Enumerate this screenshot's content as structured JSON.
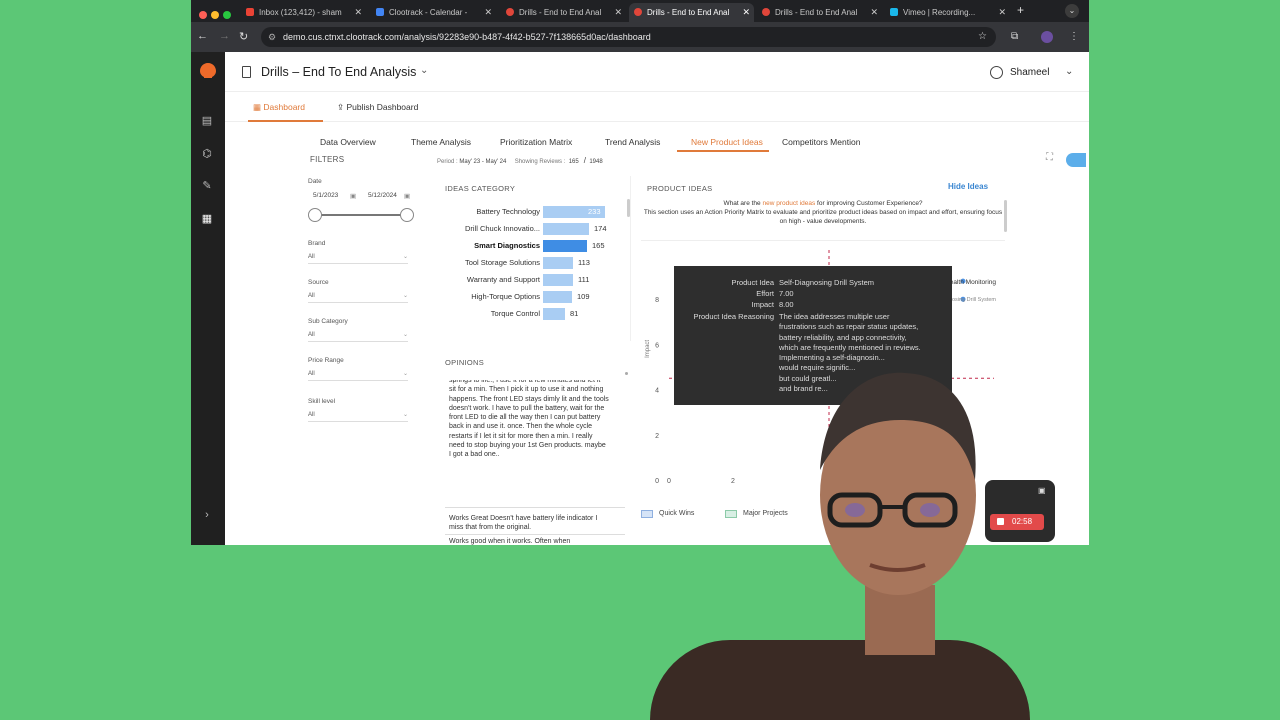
{
  "browser": {
    "tabs": [
      {
        "title": "Inbox (123,412) - sham",
        "fav": "#ea4335"
      },
      {
        "title": "Clootrack - Calendar -",
        "fav": "#4285f4"
      },
      {
        "title": "Drills - End to End Anal",
        "fav": "#e0463a"
      },
      {
        "title": "Drills - End to End Anal",
        "fav": "#e0463a"
      },
      {
        "title": "Drills - End to End Anal",
        "fav": "#e0463a"
      },
      {
        "title": "Vimeo | Recording...",
        "fav": "#1ab7ea"
      }
    ],
    "url": "demo.cus.ctnxt.clootrack.com/analysis/92283e90-b487-4f42-b527-7f138665d0ac/dashboard"
  },
  "app": {
    "title": "Drills – End To End Analysis",
    "user": "Shameel",
    "subnav": {
      "dashboard": "Dashboard",
      "publish": "Publish Dashboard"
    },
    "tabs": [
      "Data Overview",
      "Theme Analysis",
      "Prioritization Matrix",
      "Trend Analysis",
      "New Product Ideas",
      "Competitors Mention"
    ]
  },
  "filters": {
    "title": "FILTERS",
    "date_label": "Date",
    "date_from": "5/1/2023",
    "date_to": "5/12/2024",
    "brand_label": "Brand",
    "source_label": "Source",
    "subcategory_label": "Sub Category",
    "price_label": "Price Range",
    "skill_label": "Skill level",
    "all": "All"
  },
  "period": {
    "label": "Period",
    "value": "May' 23 - May' 24",
    "reviews_label": "Showing Reviews",
    "reviews_shown": "165",
    "reviews_total": "1948"
  },
  "ideas_category": {
    "title": "IDEAS CATEGORY",
    "items": [
      {
        "label": "Battery Technology",
        "value": 233
      },
      {
        "label": "Drill Chuck Innovatio...",
        "value": 174
      },
      {
        "label": "Smart Diagnostics",
        "value": 165,
        "selected": true
      },
      {
        "label": "Tool Storage Solutions",
        "value": 113
      },
      {
        "label": "Warranty and Support",
        "value": 111
      },
      {
        "label": "High-Torque Options",
        "value": 109
      },
      {
        "label": "Torque Control",
        "value": 81
      }
    ],
    "max": 233
  },
  "opinions": {
    "title": "OPINIONS",
    "items": [
      "springs to life., I use it for a few minutes and let it sit for a min. Then I pick it up to use it and nothing happens. The front LED stays dimly lit and the tools doesn't work. I have to pull the battery, wait for the front LED to die all the way then I can put battery back in and use it. once. Then the whole cycle restarts if I let it sit for more then a min. I really need to stop buying your 1st Gen products. maybe I got a bad one..",
      "Works Great Doesn't have battery life indicator I miss that from the original.",
      "Works good when it works. Often when"
    ]
  },
  "product_ideas": {
    "title": "PRODUCT IDEAS",
    "hide_label": "Hide Ideas",
    "question_pre": "What are the ",
    "question_accent": "new product ideas",
    "question_post": " for improving Customer Experience?",
    "description": "This section uses an Action Priority Matrix to evaluate and prioritize product ideas based on impact and effort, ensuring focus on high - value developments.",
    "y_axis_label": "Impact",
    "point_labels": [
      "Battery Health Monitoring",
      "Self-Diagnosing Drill System"
    ],
    "legend": [
      {
        "label": "Quick Wins",
        "fill": "#d6e4f7",
        "stroke": "#8fb0e0"
      },
      {
        "label": "Major Projects",
        "fill": "#d8efe4",
        "stroke": "#8ccaa8"
      }
    ]
  },
  "chart_data": {
    "type": "scatter",
    "title": "",
    "xlabel": "",
    "ylabel": "Impact",
    "xlim": [
      0,
      10
    ],
    "ylim": [
      0,
      10
    ],
    "x_ticks": [
      0,
      2
    ],
    "y_ticks": [
      0,
      2,
      4,
      6,
      8
    ],
    "threshold_x": 5,
    "threshold_y": 4.5,
    "points": [
      {
        "label": "Battery Health Monitoring",
        "x": 7.0,
        "y": 8.8,
        "color": "#4a90e2"
      },
      {
        "label": "Self-Diagnosing Drill System",
        "x": 7.0,
        "y": 8.0,
        "color": "#4a90e2"
      }
    ]
  },
  "tooltip": {
    "product_idea_label": "Product Idea",
    "product_idea": "Self-Diagnosing Drill System",
    "effort_label": "Effort",
    "effort": "7.00",
    "impact_label": "Impact",
    "impact": "8.00",
    "reasoning_label": "Product Idea Reasoning",
    "reasoning_lines": [
      "The idea addresses multiple user",
      "frustrations such as repair status updates,",
      "battery reliability, and app connectivity,",
      "which are frequently mentioned in reviews.",
      "Implementing a self-diagnosin...",
      "would require signific...",
      "but could greatl...",
      "and brand re..."
    ]
  },
  "recorder": {
    "time": "02:58"
  }
}
